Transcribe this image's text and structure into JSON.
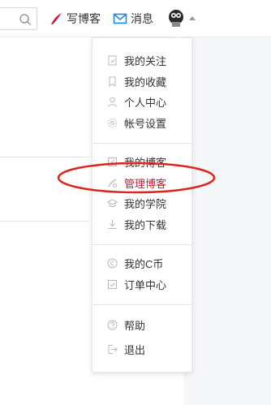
{
  "topbar": {
    "write_label": "写博客",
    "message_label": "消息"
  },
  "menu": {
    "group1": [
      {
        "label": "我的关注",
        "icon": "bookmark-page-icon"
      },
      {
        "label": "我的收藏",
        "icon": "bookmark-icon"
      },
      {
        "label": "个人中心",
        "icon": "user-icon"
      },
      {
        "label": "帐号设置",
        "icon": "gear-icon"
      }
    ],
    "group2": [
      {
        "label": "我的博客",
        "icon": "blog-icon"
      },
      {
        "label": "管理博客",
        "icon": "pen-icon"
      },
      {
        "label": "我的学院",
        "icon": "graduation-cap-icon"
      },
      {
        "label": "我的下载",
        "icon": "download-icon"
      }
    ],
    "group3": [
      {
        "label": "我的C币",
        "icon": "coin-icon"
      },
      {
        "label": "订单中心",
        "icon": "checkbox-icon"
      }
    ],
    "group4": [
      {
        "label": "帮助",
        "icon": "help-icon"
      },
      {
        "label": "退出",
        "icon": "logout-icon"
      }
    ]
  },
  "colors": {
    "accent_red": "#c6192f",
    "annotation_red": "#e0231b",
    "message_blue": "#1e88e5",
    "icon_gray": "#b8b8b8"
  }
}
